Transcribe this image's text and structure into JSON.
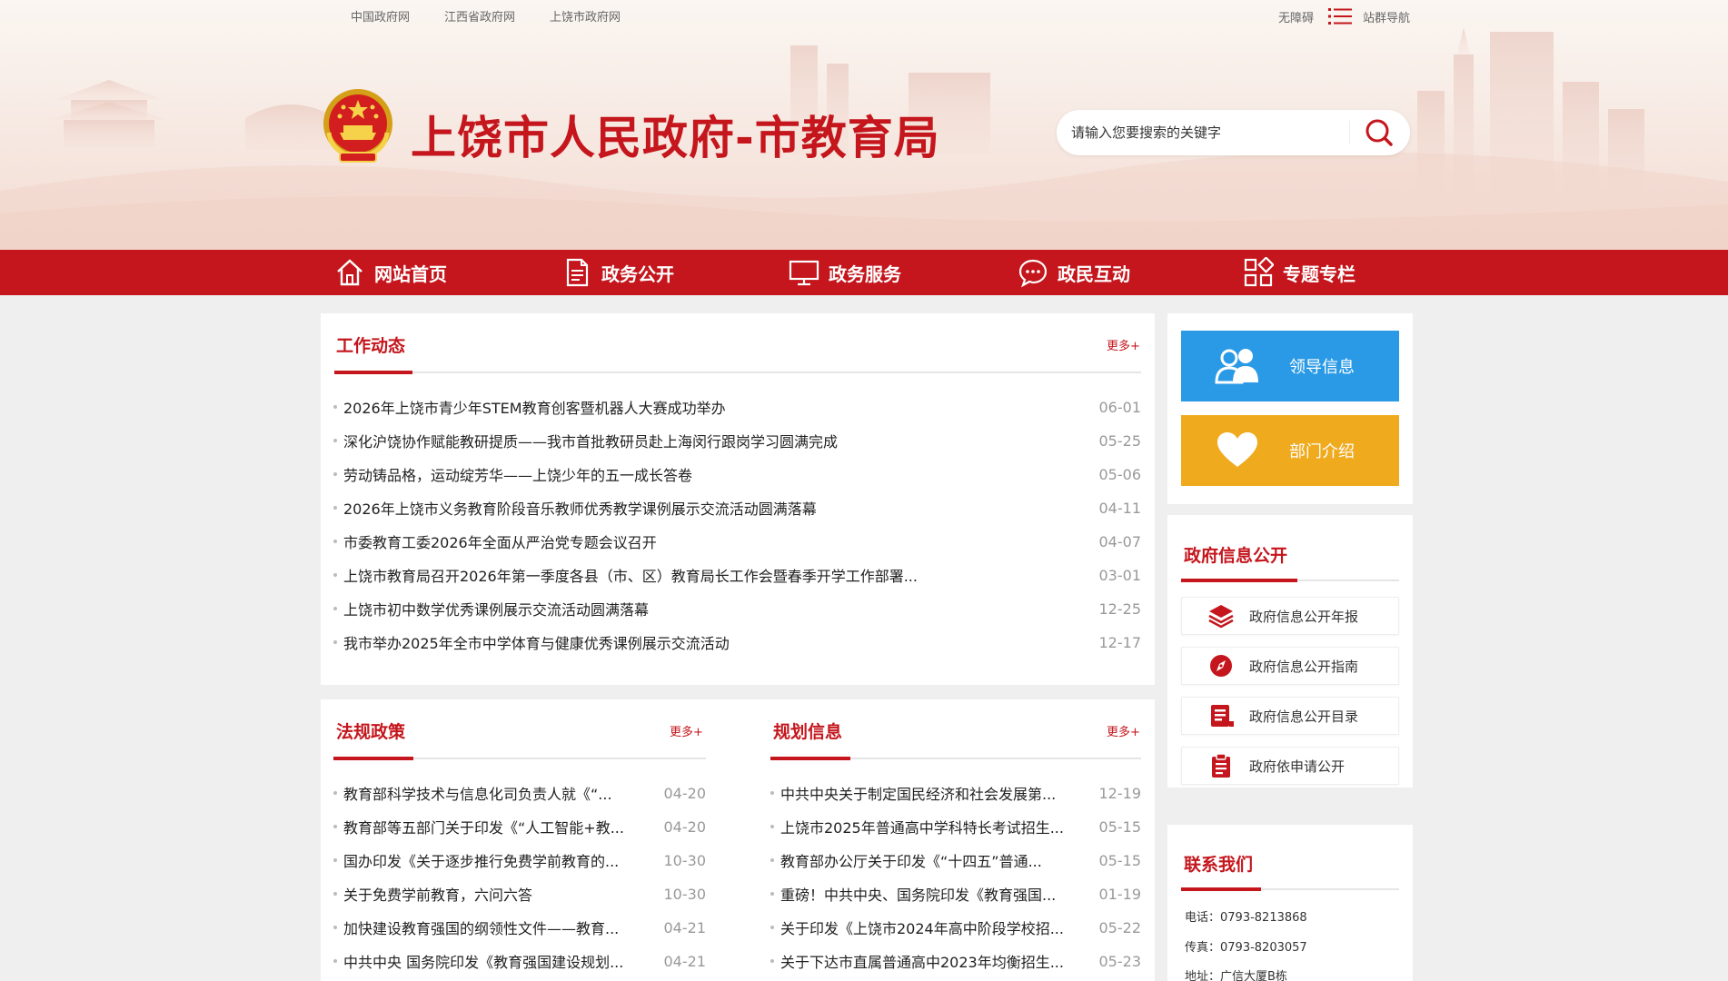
{
  "top_links": [
    "中国政府网",
    "江西省政府网",
    "上饶市政府网"
  ],
  "top_right": {
    "accessibility": "无障碍",
    "site_nav": "站群导航"
  },
  "site_title": "上饶市人民政府-市教育局",
  "search": {
    "placeholder": "请输入您要搜索的关键字"
  },
  "nav": [
    {
      "label": "网站首页",
      "icon": "home-icon"
    },
    {
      "label": "政务公开",
      "icon": "document-icon"
    },
    {
      "label": "政务服务",
      "icon": "monitor-icon"
    },
    {
      "label": "政民互动",
      "icon": "chat-icon"
    },
    {
      "label": "专题专栏",
      "icon": "grid-icon"
    }
  ],
  "work_news": {
    "title": "工作动态",
    "more": "更多+",
    "items": [
      {
        "title": "2026年上饶市青少年STEM教育创客暨机器人大赛成功举办",
        "date": "06-01"
      },
      {
        "title": "深化沪饶协作赋能教研提质——我市首批教研员赴上海闵行跟岗学习圆满完成",
        "date": "05-25"
      },
      {
        "title": "劳动铸品格，运动绽芳华——上饶少年的五一成长答卷",
        "date": "05-06"
      },
      {
        "title": "2026年上饶市义务教育阶段音乐教师优秀教学课例展示交流活动圆满落幕",
        "date": "04-11"
      },
      {
        "title": "市委教育工委2026年全面从严治党专题会议召开",
        "date": "04-07"
      },
      {
        "title": "上饶市教育局召开2026年第一季度各县（市、区）教育局长工作会暨春季开学工作部署...",
        "date": "03-01"
      },
      {
        "title": "上饶市初中数学优秀课例展示交流活动圆满落幕",
        "date": "12-25"
      },
      {
        "title": "我市举办2025年全市中学体育与健康优秀课例展示交流活动",
        "date": "12-17"
      }
    ]
  },
  "policy": {
    "title": "法规政策",
    "more": "更多+",
    "items": [
      {
        "title": "教育部科学技术与信息化司负责人就《“...",
        "date": "04-20"
      },
      {
        "title": "教育部等五部门关于印发《“人工智能+教...",
        "date": "04-20"
      },
      {
        "title": "国办印发《关于逐步推行免费学前教育的...",
        "date": "10-30"
      },
      {
        "title": "关于免费学前教育，六问六答",
        "date": "10-30"
      },
      {
        "title": "加快建设教育强国的纲领性文件——教育...",
        "date": "04-21"
      },
      {
        "title": "中共中央 国务院印发《教育强国建设规划...",
        "date": "04-21"
      }
    ]
  },
  "planning": {
    "title": "规划信息",
    "more": "更多+",
    "items": [
      {
        "title": "中共中央关于制定国民经济和社会发展第...",
        "date": "12-19"
      },
      {
        "title": "上饶市2025年普通高中学科特长考试招生...",
        "date": "05-15"
      },
      {
        "title": "教育部办公厅关于印发《“十四五”普通...",
        "date": "05-15"
      },
      {
        "title": "重磅！中共中央、国务院印发《教育强国...",
        "date": "01-19"
      },
      {
        "title": "关于印发《上饶市2024年高中阶段学校招...",
        "date": "05-22"
      },
      {
        "title": "关于下达市直属普通高中2023年均衡招生...",
        "date": "05-23"
      }
    ]
  },
  "sidebar": {
    "leader_label": "领导信息",
    "leader_color": "#2a9ae6",
    "dept_label": "部门介绍",
    "dept_color": "#f0aa1e",
    "gov_info_title": "政府信息公开",
    "gov_info_items": [
      {
        "label": "政府信息公开年报",
        "icon": "stack-icon"
      },
      {
        "label": "政府信息公开指南",
        "icon": "compass-icon"
      },
      {
        "label": "政府信息公开目录",
        "icon": "catalog-icon"
      },
      {
        "label": "政府依申请公开",
        "icon": "clipboard-icon"
      }
    ],
    "contact_title": "联系我们",
    "phone": "电话：0793-8213868",
    "fax": "传真：0793-8203057",
    "address": "地址：广信大厦B栋"
  },
  "colors": {
    "brand_red": "#c4161c",
    "bg": "#efefef"
  }
}
